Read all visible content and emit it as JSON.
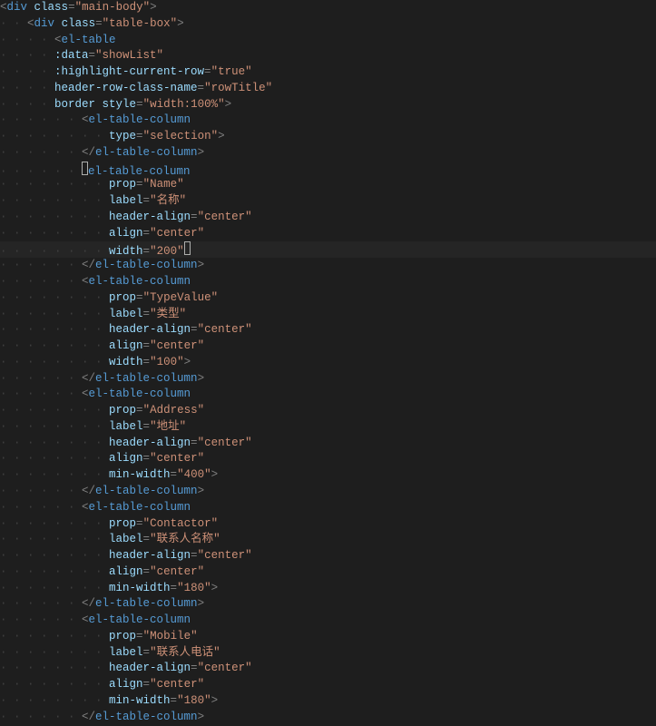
{
  "lines": [
    {
      "indent": 0,
      "segs": [
        [
          "punct",
          "<"
        ],
        [
          "tag",
          "div"
        ],
        [
          "plain",
          " "
        ],
        [
          "attr",
          "class"
        ],
        [
          "punct",
          "="
        ],
        [
          "str",
          "\"main-body\""
        ],
        [
          "punct",
          ">"
        ]
      ]
    },
    {
      "indent": 1,
      "segs": [
        [
          "punct",
          "<"
        ],
        [
          "tag",
          "div"
        ],
        [
          "plain",
          " "
        ],
        [
          "attr",
          "class"
        ],
        [
          "punct",
          "="
        ],
        [
          "str",
          "\"table-box\""
        ],
        [
          "punct",
          ">"
        ]
      ]
    },
    {
      "indent": 2,
      "segs": [
        [
          "punct",
          "<"
        ],
        [
          "tag",
          "el-table"
        ]
      ]
    },
    {
      "indent": 2,
      "segs": [
        [
          "attr",
          ":data"
        ],
        [
          "punct",
          "="
        ],
        [
          "str",
          "\"showList\""
        ]
      ]
    },
    {
      "indent": 2,
      "segs": [
        [
          "attr",
          ":highlight-current-row"
        ],
        [
          "punct",
          "="
        ],
        [
          "str",
          "\"true\""
        ]
      ]
    },
    {
      "indent": 2,
      "segs": [
        [
          "attr",
          "header-row-class-name"
        ],
        [
          "punct",
          "="
        ],
        [
          "str",
          "\"rowTitle\""
        ]
      ]
    },
    {
      "indent": 2,
      "segs": [
        [
          "attr",
          "border"
        ],
        [
          "plain",
          " "
        ],
        [
          "attr",
          "style"
        ],
        [
          "punct",
          "="
        ],
        [
          "str",
          "\"width:100%\""
        ],
        [
          "punct",
          ">"
        ]
      ]
    },
    {
      "indent": 3,
      "segs": [
        [
          "punct",
          "<"
        ],
        [
          "tag",
          "el-table-column"
        ]
      ]
    },
    {
      "indent": 4,
      "segs": [
        [
          "attr",
          "type"
        ],
        [
          "punct",
          "="
        ],
        [
          "str",
          "\"selection\""
        ],
        [
          "punct",
          ">"
        ]
      ]
    },
    {
      "indent": 3,
      "segs": [
        [
          "punct",
          "</"
        ],
        [
          "tag",
          "el-table-column"
        ],
        [
          "punct",
          ">"
        ]
      ]
    },
    {
      "indent": 3,
      "cursorStart": true,
      "segs": [
        [
          "tag",
          "el-table-column"
        ]
      ]
    },
    {
      "indent": 4,
      "segs": [
        [
          "attr",
          "prop"
        ],
        [
          "punct",
          "="
        ],
        [
          "str",
          "\"Name\""
        ]
      ]
    },
    {
      "indent": 4,
      "segs": [
        [
          "attr",
          "label"
        ],
        [
          "punct",
          "="
        ],
        [
          "str",
          "\"名称\""
        ]
      ]
    },
    {
      "indent": 4,
      "segs": [
        [
          "attr",
          "header-align"
        ],
        [
          "punct",
          "="
        ],
        [
          "str",
          "\"center\""
        ]
      ]
    },
    {
      "indent": 4,
      "segs": [
        [
          "attr",
          "align"
        ],
        [
          "punct",
          "="
        ],
        [
          "str",
          "\"center\""
        ]
      ]
    },
    {
      "indent": 4,
      "current": true,
      "cursorEnd": true,
      "segs": [
        [
          "attr",
          "width"
        ],
        [
          "punct",
          "="
        ],
        [
          "str",
          "\"200\""
        ]
      ]
    },
    {
      "indent": 3,
      "segs": [
        [
          "punct",
          "</"
        ],
        [
          "tag",
          "el-table-column"
        ],
        [
          "punct",
          ">"
        ]
      ]
    },
    {
      "indent": 3,
      "segs": [
        [
          "punct",
          "<"
        ],
        [
          "tag",
          "el-table-column"
        ]
      ]
    },
    {
      "indent": 4,
      "segs": [
        [
          "attr",
          "prop"
        ],
        [
          "punct",
          "="
        ],
        [
          "str",
          "\"TypeValue\""
        ]
      ]
    },
    {
      "indent": 4,
      "segs": [
        [
          "attr",
          "label"
        ],
        [
          "punct",
          "="
        ],
        [
          "str",
          "\"类型\""
        ]
      ]
    },
    {
      "indent": 4,
      "segs": [
        [
          "attr",
          "header-align"
        ],
        [
          "punct",
          "="
        ],
        [
          "str",
          "\"center\""
        ]
      ]
    },
    {
      "indent": 4,
      "segs": [
        [
          "attr",
          "align"
        ],
        [
          "punct",
          "="
        ],
        [
          "str",
          "\"center\""
        ]
      ]
    },
    {
      "indent": 4,
      "segs": [
        [
          "attr",
          "width"
        ],
        [
          "punct",
          "="
        ],
        [
          "str",
          "\"100\""
        ],
        [
          "punct",
          ">"
        ]
      ]
    },
    {
      "indent": 3,
      "segs": [
        [
          "punct",
          "</"
        ],
        [
          "tag",
          "el-table-column"
        ],
        [
          "punct",
          ">"
        ]
      ]
    },
    {
      "indent": 3,
      "segs": [
        [
          "punct",
          "<"
        ],
        [
          "tag",
          "el-table-column"
        ]
      ]
    },
    {
      "indent": 4,
      "segs": [
        [
          "attr",
          "prop"
        ],
        [
          "punct",
          "="
        ],
        [
          "str",
          "\"Address\""
        ]
      ]
    },
    {
      "indent": 4,
      "segs": [
        [
          "attr",
          "label"
        ],
        [
          "punct",
          "="
        ],
        [
          "str",
          "\"地址\""
        ]
      ]
    },
    {
      "indent": 4,
      "segs": [
        [
          "attr",
          "header-align"
        ],
        [
          "punct",
          "="
        ],
        [
          "str",
          "\"center\""
        ]
      ]
    },
    {
      "indent": 4,
      "segs": [
        [
          "attr",
          "align"
        ],
        [
          "punct",
          "="
        ],
        [
          "str",
          "\"center\""
        ]
      ]
    },
    {
      "indent": 4,
      "segs": [
        [
          "attr",
          "min-width"
        ],
        [
          "punct",
          "="
        ],
        [
          "str",
          "\"400\""
        ],
        [
          "punct",
          ">"
        ]
      ]
    },
    {
      "indent": 3,
      "segs": [
        [
          "punct",
          "</"
        ],
        [
          "tag",
          "el-table-column"
        ],
        [
          "punct",
          ">"
        ]
      ]
    },
    {
      "indent": 3,
      "segs": [
        [
          "punct",
          "<"
        ],
        [
          "tag",
          "el-table-column"
        ]
      ]
    },
    {
      "indent": 4,
      "segs": [
        [
          "attr",
          "prop"
        ],
        [
          "punct",
          "="
        ],
        [
          "str",
          "\"Contactor\""
        ]
      ]
    },
    {
      "indent": 4,
      "segs": [
        [
          "attr",
          "label"
        ],
        [
          "punct",
          "="
        ],
        [
          "str",
          "\"联系人名称\""
        ]
      ]
    },
    {
      "indent": 4,
      "segs": [
        [
          "attr",
          "header-align"
        ],
        [
          "punct",
          "="
        ],
        [
          "str",
          "\"center\""
        ]
      ]
    },
    {
      "indent": 4,
      "segs": [
        [
          "attr",
          "align"
        ],
        [
          "punct",
          "="
        ],
        [
          "str",
          "\"center\""
        ]
      ]
    },
    {
      "indent": 4,
      "segs": [
        [
          "attr",
          "min-width"
        ],
        [
          "punct",
          "="
        ],
        [
          "str",
          "\"180\""
        ],
        [
          "punct",
          ">"
        ]
      ]
    },
    {
      "indent": 3,
      "segs": [
        [
          "punct",
          "</"
        ],
        [
          "tag",
          "el-table-column"
        ],
        [
          "punct",
          ">"
        ]
      ]
    },
    {
      "indent": 3,
      "segs": [
        [
          "punct",
          "<"
        ],
        [
          "tag",
          "el-table-column"
        ]
      ]
    },
    {
      "indent": 4,
      "segs": [
        [
          "attr",
          "prop"
        ],
        [
          "punct",
          "="
        ],
        [
          "str",
          "\"Mobile\""
        ]
      ]
    },
    {
      "indent": 4,
      "segs": [
        [
          "attr",
          "label"
        ],
        [
          "punct",
          "="
        ],
        [
          "str",
          "\"联系人电话\""
        ]
      ]
    },
    {
      "indent": 4,
      "segs": [
        [
          "attr",
          "header-align"
        ],
        [
          "punct",
          "="
        ],
        [
          "str",
          "\"center\""
        ]
      ]
    },
    {
      "indent": 4,
      "segs": [
        [
          "attr",
          "align"
        ],
        [
          "punct",
          "="
        ],
        [
          "str",
          "\"center\""
        ]
      ]
    },
    {
      "indent": 4,
      "segs": [
        [
          "attr",
          "min-width"
        ],
        [
          "punct",
          "="
        ],
        [
          "str",
          "\"180\""
        ],
        [
          "punct",
          ">"
        ]
      ]
    },
    {
      "indent": 3,
      "segs": [
        [
          "punct",
          "</"
        ],
        [
          "tag",
          "el-table-column"
        ],
        [
          "punct",
          ">"
        ]
      ]
    }
  ],
  "indentUnit": "· · "
}
